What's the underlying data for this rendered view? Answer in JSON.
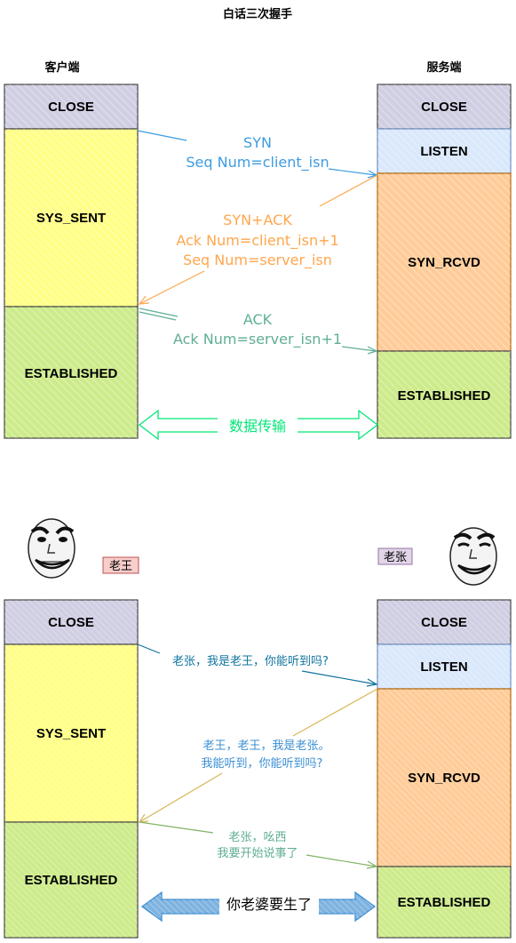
{
  "title": "白话三次握手",
  "client_label": "客户端",
  "server_label": "服务端",
  "states": {
    "close": "CLOSE",
    "listen": "LISTEN",
    "syn_sent": "SYS_SENT",
    "syn_rcvd": "SYN_RCVD",
    "established": "ESTABLISHED"
  },
  "top": {
    "syn": [
      "SYN",
      "Seq Num=client_isn"
    ],
    "synack": [
      "SYN+ACK",
      "Ack Num=client_isn+1",
      "Seq Num=server_isn"
    ],
    "ack": [
      "ACK",
      "Ack Num=server_isn+1"
    ],
    "transfer": "数据传输"
  },
  "bottom": {
    "client_name": "老王",
    "server_name": "老张",
    "msg1": "老张，我是老王，你能听到吗?",
    "msg2": [
      "老王，老王，我是老张。",
      "我能听到，你能听到吗?"
    ],
    "msg3": [
      "老张，吆西",
      "我要开始说事了"
    ],
    "transfer": "你老婆要生了"
  },
  "colors": {
    "close": "#d0cee2",
    "listen": "#dae8fc",
    "yellow": "#ffff88",
    "orange": "#ffcc99",
    "green": "#cdeb8b",
    "syn": "#3d9ce0",
    "synack": "#ffa64d",
    "ack": "#5fae95",
    "transfer": "#00e676",
    "msg1": "#10739e",
    "msg2": "#d6b656",
    "msg3": "#82b366",
    "transfer2": "#3b8fd4"
  }
}
